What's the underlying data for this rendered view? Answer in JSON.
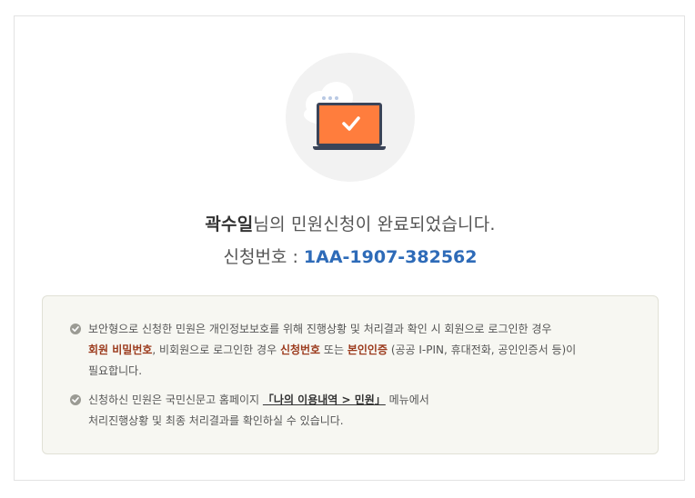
{
  "result": {
    "user_name": "곽수일",
    "title_rest": "님의 민원신청이 완료되었습니다.",
    "appno_label": "신청번호 : ",
    "appno_value": "1AA-1907-382562"
  },
  "icons": {
    "illustration": "laptop-check-icon",
    "bullet": "check-circle-icon"
  },
  "notice": {
    "item1": {
      "part1": "보안형으로 신청한 민원은 개인정보보호를 위해 진행상황 및 처리결과 확인 시 회원으로 로그인한 경우",
      "member_pw": "회원 비밀번호",
      "part2": ", 비회원으로 로그인한 경우 ",
      "appno": "신청번호",
      "part3": " 또는 ",
      "auth": "본인인증",
      "part4": " (공공 I-PIN, 휴대전화, 공인인증서 등)이",
      "part5": "필요합니다."
    },
    "item2": {
      "part1": "신청하신 민원은 국민신문고 홈페이지 ",
      "link": "「나의 이용내역 > 민원」",
      "part2": " 메뉴에서",
      "part3": "처리진행상황 및 최종 처리결과를 확인하실 수 있습니다."
    }
  },
  "colors": {
    "accent_blue": "#2e6bb8",
    "emphasis_red": "#9b3a1c",
    "laptop_orange": "#ff7d3d"
  }
}
